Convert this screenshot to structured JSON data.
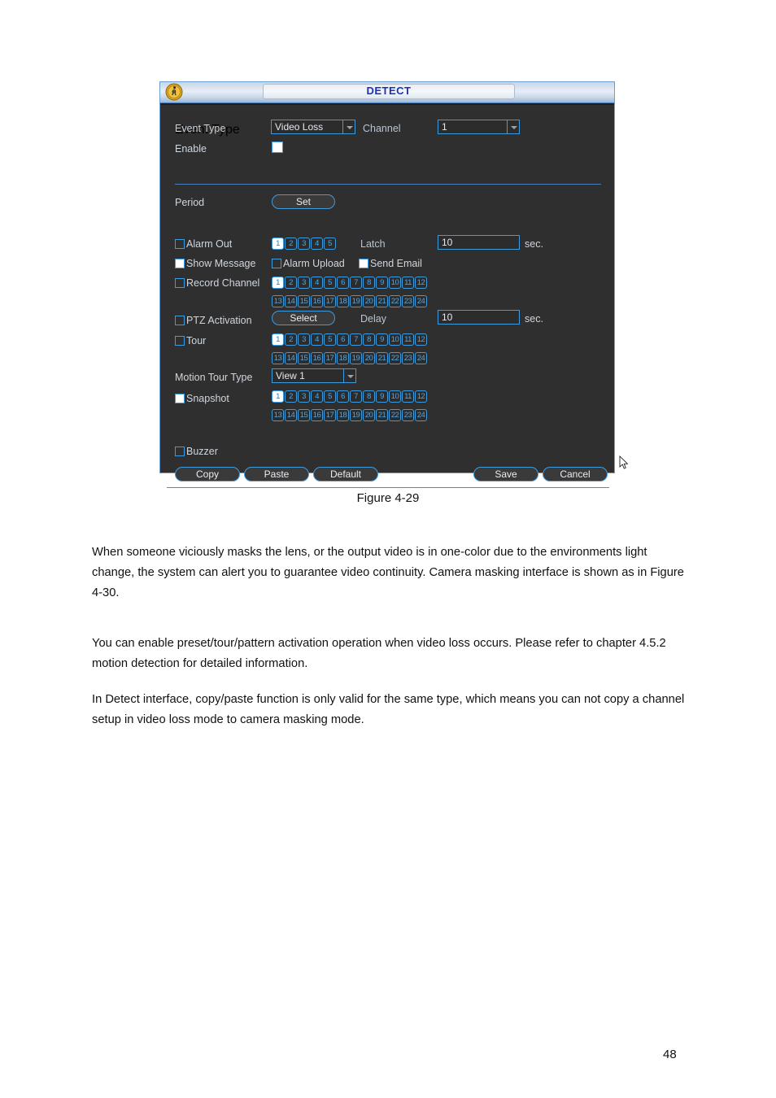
{
  "window": {
    "title": "DETECT",
    "title_icon": "walking-person-icon"
  },
  "form": {
    "event_type_label": "Event Type",
    "event_type_value": "Video Loss",
    "channel_label": "Channel",
    "channel_value": "1",
    "enable_label": "Enable",
    "enable_checked": true,
    "period_label": "Period",
    "period_button": "Set",
    "alarm_out_label": "Alarm Out",
    "alarm_out_checked": false,
    "alarm_out_channels": [
      "1",
      "2",
      "3",
      "4",
      "5"
    ],
    "alarm_out_selected": [
      "1"
    ],
    "latch_label": "Latch",
    "latch_value": "10",
    "latch_unit": "sec.",
    "show_message_label": "Show Message",
    "show_message_checked": true,
    "alarm_upload_label": "Alarm Upload",
    "alarm_upload_checked": false,
    "send_email_label": "Send Email",
    "send_email_checked": true,
    "record_channel_label": "Record Channel",
    "record_channel_checked": false,
    "ptz_activation_label": "PTZ Activation",
    "ptz_activation_checked": false,
    "ptz_button": "Select",
    "delay_label": "Delay",
    "delay_value": "10",
    "delay_unit": "sec.",
    "tour_label": "Tour",
    "tour_checked": false,
    "motion_tour_type_label": "Motion Tour Type",
    "motion_tour_type_value": "View 1",
    "snapshot_label": "Snapshot",
    "snapshot_checked": true,
    "buzzer_label": "Buzzer",
    "buzzer_checked": false,
    "channels_24": [
      "1",
      "2",
      "3",
      "4",
      "5",
      "6",
      "7",
      "8",
      "9",
      "10",
      "11",
      "12",
      "13",
      "14",
      "15",
      "16",
      "17",
      "18",
      "19",
      "20",
      "21",
      "22",
      "23",
      "24"
    ],
    "record_channel_selected": [
      "1"
    ],
    "tour_selected": [
      "1"
    ],
    "snapshot_selected": [
      "1"
    ]
  },
  "buttons": {
    "copy": "Copy",
    "paste": "Paste",
    "default": "Default",
    "save": "Save",
    "cancel": "Cancel"
  },
  "document": {
    "figure_caption": "Figure 4-29",
    "paragraph1": "When someone viciously masks the lens, or the output video is in one-color due to the environments light change, the system can alert you to guarantee video continuity. Camera masking interface is shown as in Figure 4-30.",
    "paragraph2": "You can enable preset/tour/pattern activation operation when video loss occurs. Please refer to chapter 4.5.2 motion detection for detailed information.",
    "paragraph3": "In Detect interface, copy/paste function is only valid for the same type, which means you can not copy a channel setup in video loss mode to camera masking mode.",
    "page_number": "48"
  },
  "colors": {
    "accent_blue": "#3e9bdd",
    "panel_bg": "#2f2f2f",
    "title_text": "#1a2fc0",
    "label_text": "#cfd6de"
  }
}
